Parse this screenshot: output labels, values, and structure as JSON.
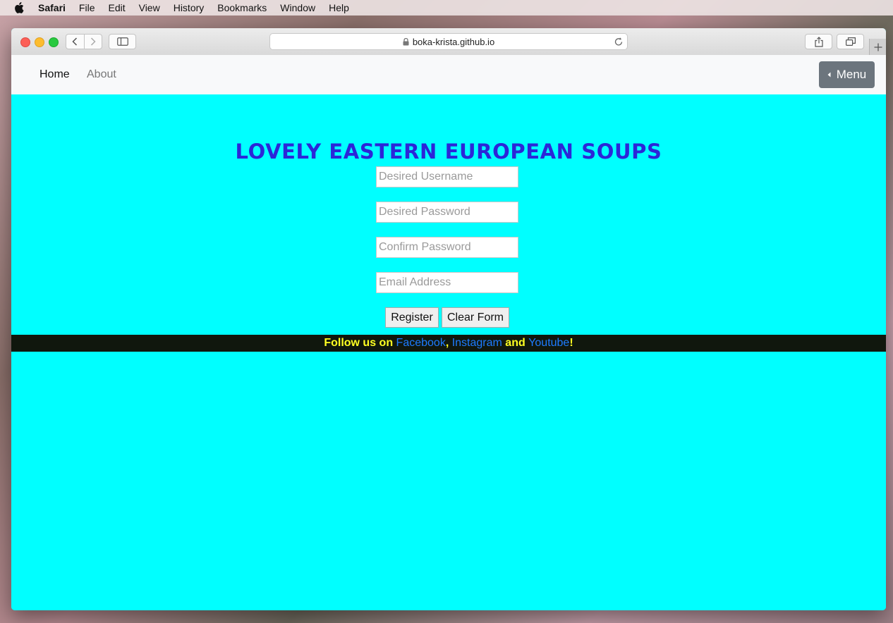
{
  "menubar": {
    "items": [
      "Safari",
      "File",
      "Edit",
      "View",
      "History",
      "Bookmarks",
      "Window",
      "Help"
    ]
  },
  "browser": {
    "url": "boka-krista.github.io"
  },
  "navbar": {
    "home": "Home",
    "about": "About",
    "menu_button": "Menu"
  },
  "main": {
    "title": "LOVELY EASTERN EUROPEAN SOUPS",
    "form": {
      "username_placeholder": "Desired Username",
      "password_placeholder": "Desired Password",
      "confirm_placeholder": "Confirm Password",
      "email_placeholder": "Email Address",
      "register_label": "Register",
      "clear_label": "Clear Form"
    }
  },
  "footer": {
    "prefix": "Follow us on ",
    "facebook": "Facebook",
    "sep1": ", ",
    "instagram": "Instagram",
    "sep2": " and ",
    "youtube": "Youtube",
    "suffix": "!"
  },
  "colors": {
    "page_background": "#00ffff",
    "title": "#2c26d8",
    "footer_background": "#10170d",
    "footer_text": "#ffff22",
    "footer_link": "#1e7bff",
    "menu_button": "#6c757d"
  }
}
